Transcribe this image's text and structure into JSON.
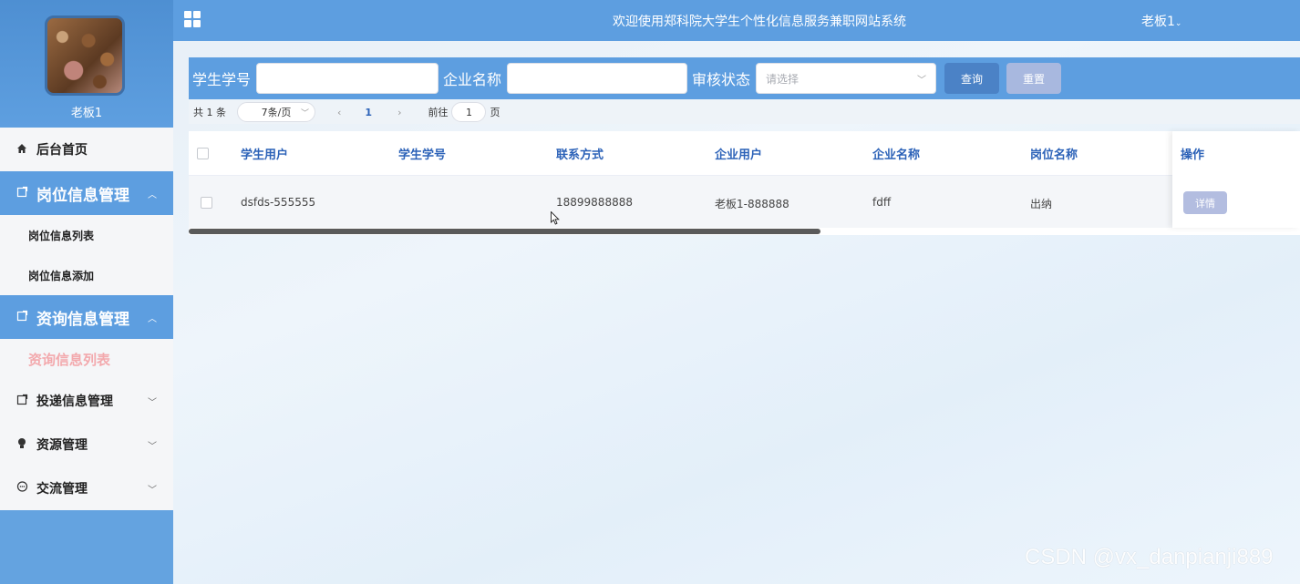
{
  "header": {
    "title": "欢迎使用郑科院大学生个性化信息服务兼职网站系统",
    "user_menu": "老板1"
  },
  "sidebar": {
    "username": "老板1",
    "menu": {
      "home": "后台首页",
      "jobs": "岗位信息管理",
      "jobs_list": "岗位信息列表",
      "jobs_add": "岗位信息添加",
      "consult": "资询信息管理",
      "consult_list": "资询信息列表",
      "delivery": "投递信息管理",
      "resource": "资源管理",
      "exchange": "交流管理"
    }
  },
  "search": {
    "student_no_label": "学生学号",
    "student_no_value": "",
    "company_label": "企业名称",
    "company_value": "",
    "status_label": "审核状态",
    "status_placeholder": "请选择",
    "query_button": "查询",
    "reset_button": "重置"
  },
  "pagination": {
    "total": "共 1 条",
    "page_size": "7条/页",
    "current_page": "1",
    "goto_label": "前往",
    "goto_value": "1",
    "page_suffix": "页"
  },
  "table": {
    "columns": [
      "学生用户",
      "学生学号",
      "联系方式",
      "企业用户",
      "企业名称",
      "岗位名称",
      "操作"
    ],
    "rows": [
      {
        "student_user": "dsfds-555555",
        "student_no": "",
        "contact": "18899888888",
        "company_user": "老板1-888888",
        "company_name": "fdff",
        "job_name": "出纳",
        "action": "详情"
      }
    ]
  },
  "watermark": "CSDN @vx_danpianji889",
  "colors": {
    "primary": "#5d9ee0",
    "header_text": "#2c62b8",
    "active_submenu": "#f3a9ad",
    "query_button": "#4b82c6",
    "reset_button": "#a8b8df",
    "detail_button": "#b3bde0"
  }
}
